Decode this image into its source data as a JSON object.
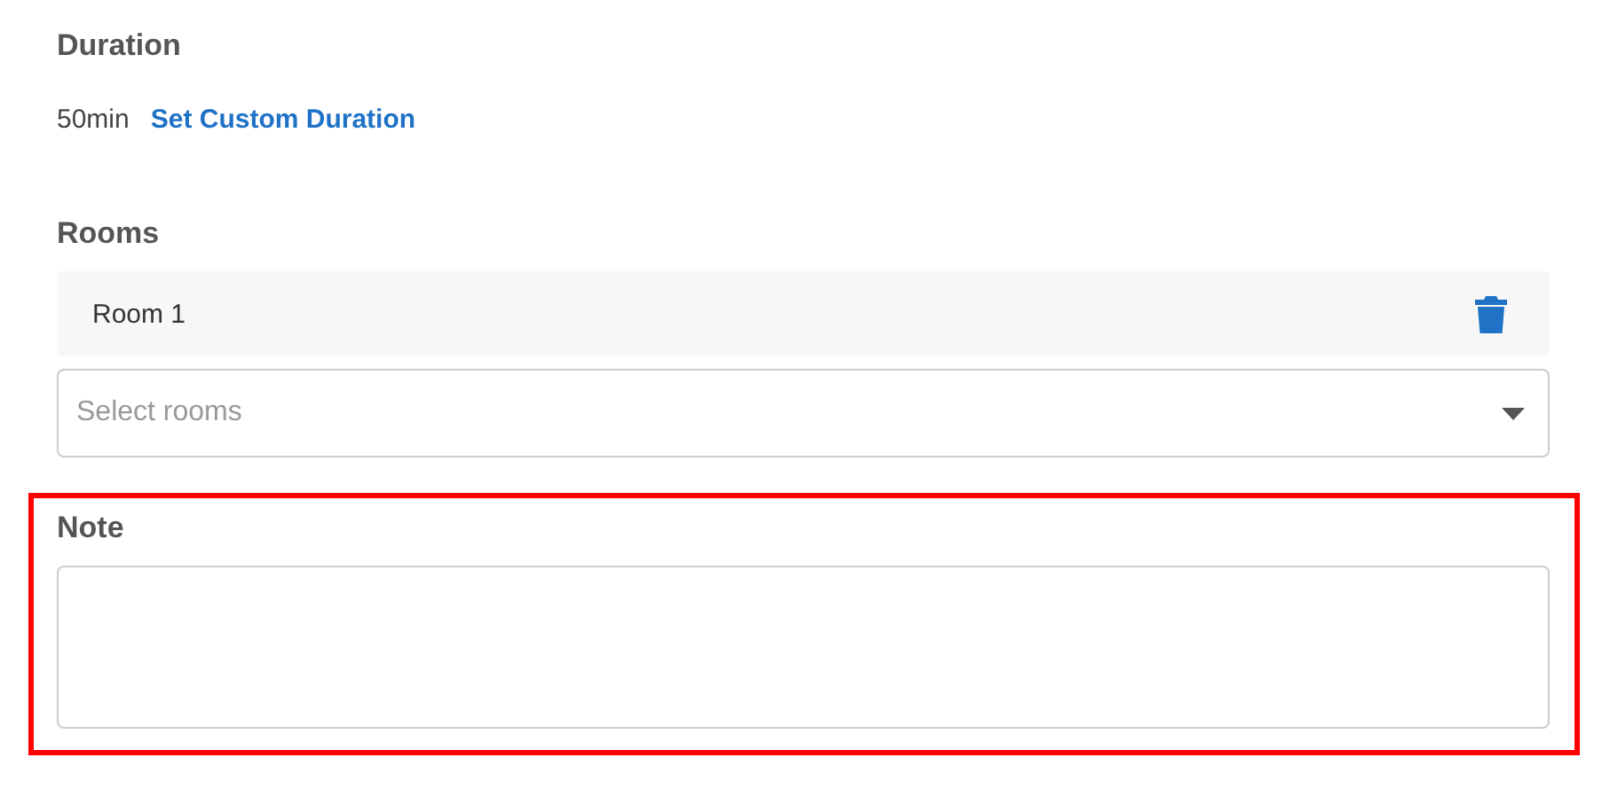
{
  "duration": {
    "label": "Duration",
    "value": "50min",
    "link": "Set Custom Duration"
  },
  "rooms": {
    "label": "Rooms",
    "items": [
      {
        "name": "Room 1"
      }
    ],
    "select": {
      "placeholder": "Select rooms"
    }
  },
  "note": {
    "label": "Note",
    "highlighted": true
  }
}
